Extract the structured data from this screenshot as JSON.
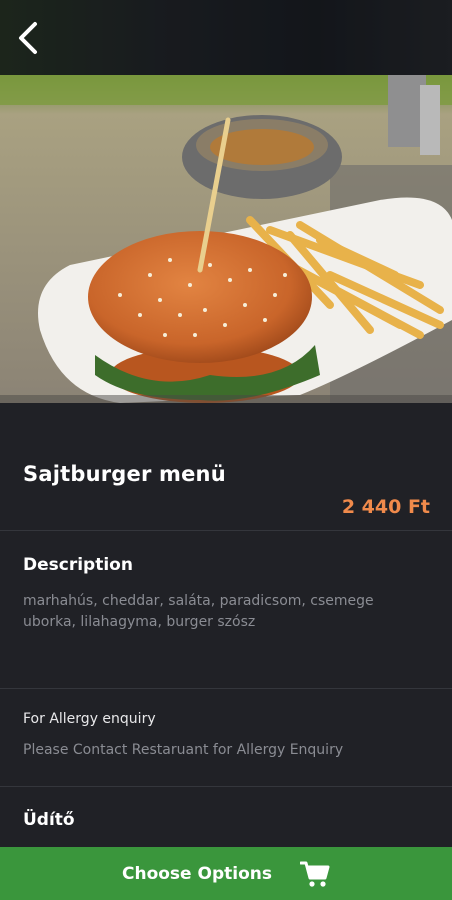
{
  "header": {
    "back_icon": "back-arrow-icon"
  },
  "product": {
    "name": "Sajtburger menü",
    "price": "2 440 Ft"
  },
  "description": {
    "heading": "Description",
    "text": "marhahús, cheddar, saláta, paradicsom, csemege uborka, lilahagyma, burger szósz"
  },
  "allergy": {
    "heading": "For Allergy enquiry",
    "text": "Please Contact Restaruant for Allergy Enquiry"
  },
  "category": {
    "heading": "Üdítő"
  },
  "cta": {
    "label": "Choose Options",
    "icon": "shopping-cart-icon"
  },
  "colors": {
    "accent_price": "#f08a4b",
    "cta_green": "#3a963c",
    "background": "#202126"
  }
}
